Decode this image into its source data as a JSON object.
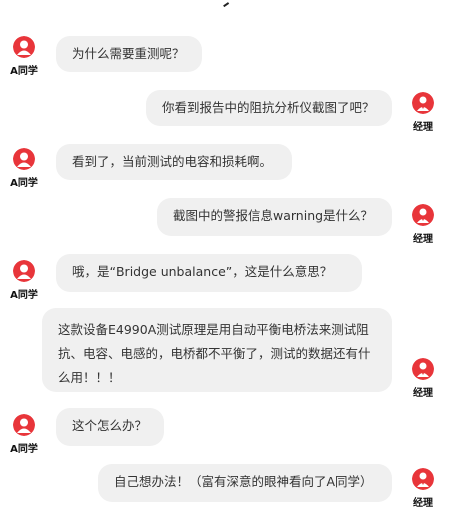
{
  "colors": {
    "avatar_bg": "#e8353a",
    "bubble_bg": "#f0f0f0",
    "text": "#333333"
  },
  "participants": {
    "student": {
      "name": "A同学",
      "icon": "user-icon"
    },
    "manager": {
      "name": "经理",
      "icon": "manager-icon"
    }
  },
  "messages": [
    {
      "sender": "A同学",
      "side": "left",
      "text": "为什么需要重测呢？"
    },
    {
      "sender": "经理",
      "side": "right",
      "text": "你看到报告中的阻抗分析仪截图了吧？"
    },
    {
      "sender": "A同学",
      "side": "left",
      "text": "看到了，当前测试的电容和损耗啊。"
    },
    {
      "sender": "经理",
      "side": "right",
      "text": "截图中的警报信息warning是什么？"
    },
    {
      "sender": "A同学",
      "side": "left",
      "text": "哦，是“Bridge unbalance”，这是什么意思？"
    },
    {
      "sender": "经理",
      "side": "right",
      "text": "这款设备E4990A测试原理是用自动平衡电桥法来测试阻抗、电容、电感的，电桥都不平衡了，测试的数据还有什么用！！！"
    },
    {
      "sender": "A同学",
      "side": "left",
      "text": "这个怎么办？"
    },
    {
      "sender": "经理",
      "side": "right",
      "text": "自己想办法！（富有深意的眼神看向了A同学）"
    }
  ]
}
